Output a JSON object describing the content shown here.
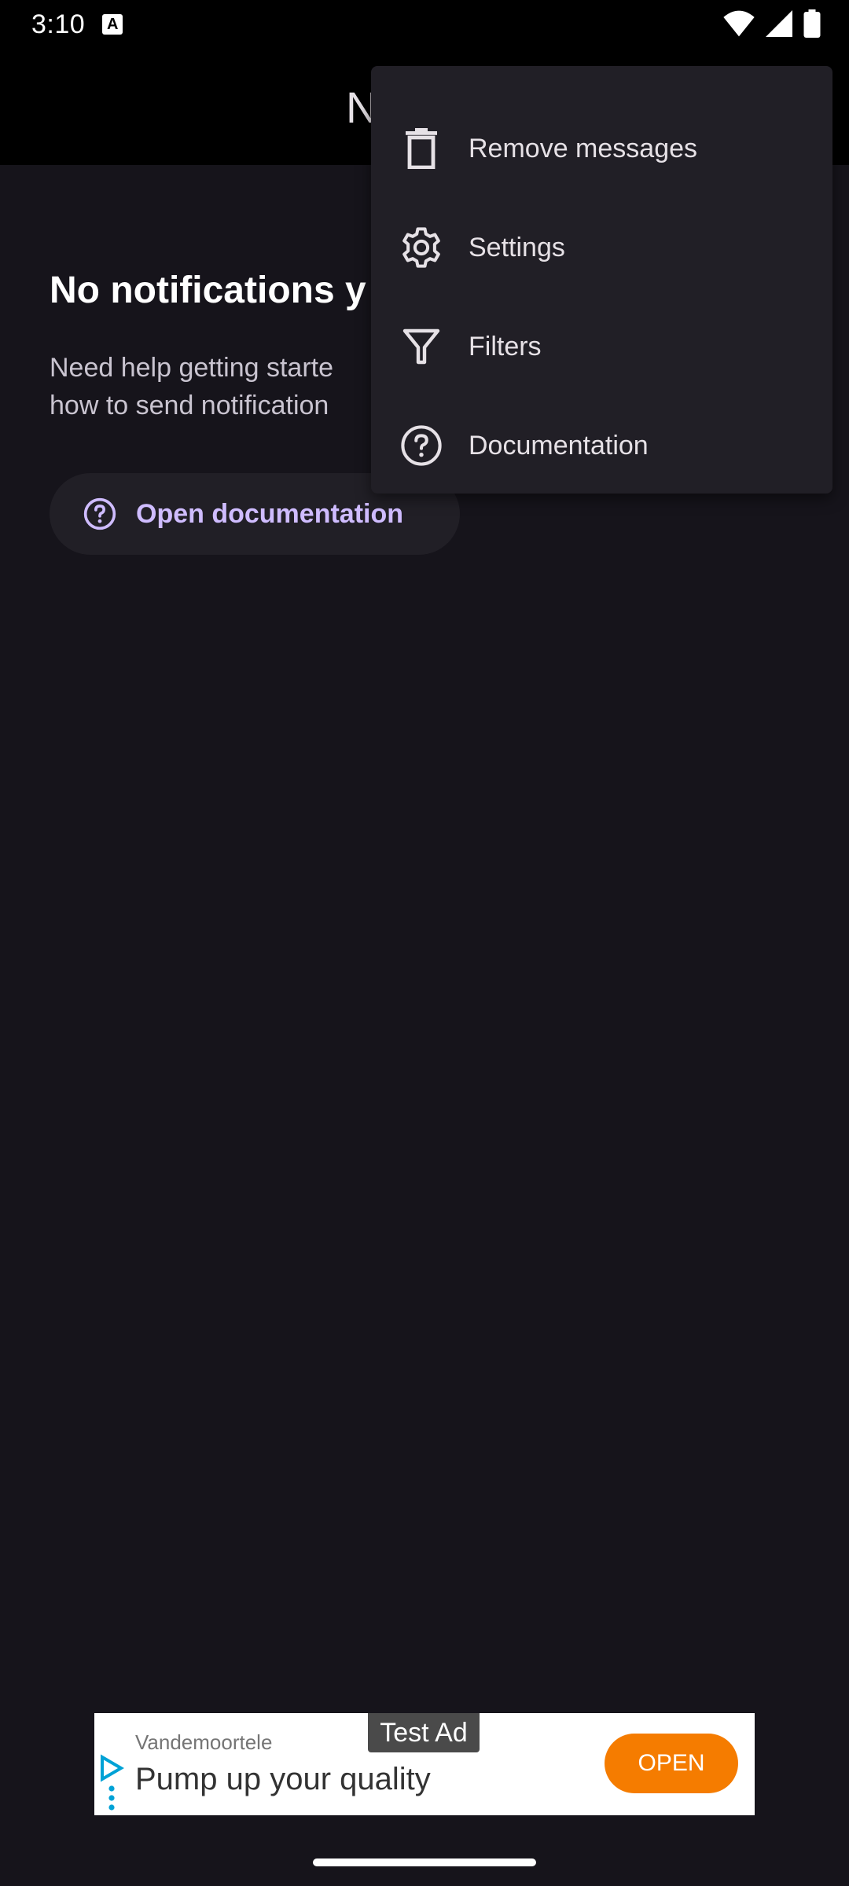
{
  "status_bar": {
    "time": "3:10",
    "notification_icon": "A"
  },
  "app_bar": {
    "title_partial": "N"
  },
  "empty_state": {
    "title": "No notifications y",
    "description_line1": "Need help getting starte",
    "description_line2": "how to send notification",
    "open_docs_label": "Open documentation"
  },
  "menu": {
    "items": [
      {
        "label": "Remove messages",
        "icon": "trash-icon"
      },
      {
        "label": "Settings",
        "icon": "gear-icon"
      },
      {
        "label": "Filters",
        "icon": "filter-icon"
      },
      {
        "label": "Documentation",
        "icon": "help-icon"
      }
    ]
  },
  "ad": {
    "badge": "Test Ad",
    "advertiser": "Vandemoortele",
    "headline": "Pump up your quality",
    "cta": "OPEN"
  },
  "colors": {
    "background": "#16141b",
    "surface": "#211f26",
    "accent": "#cfbcff",
    "ad_cta": "#f57c00"
  }
}
